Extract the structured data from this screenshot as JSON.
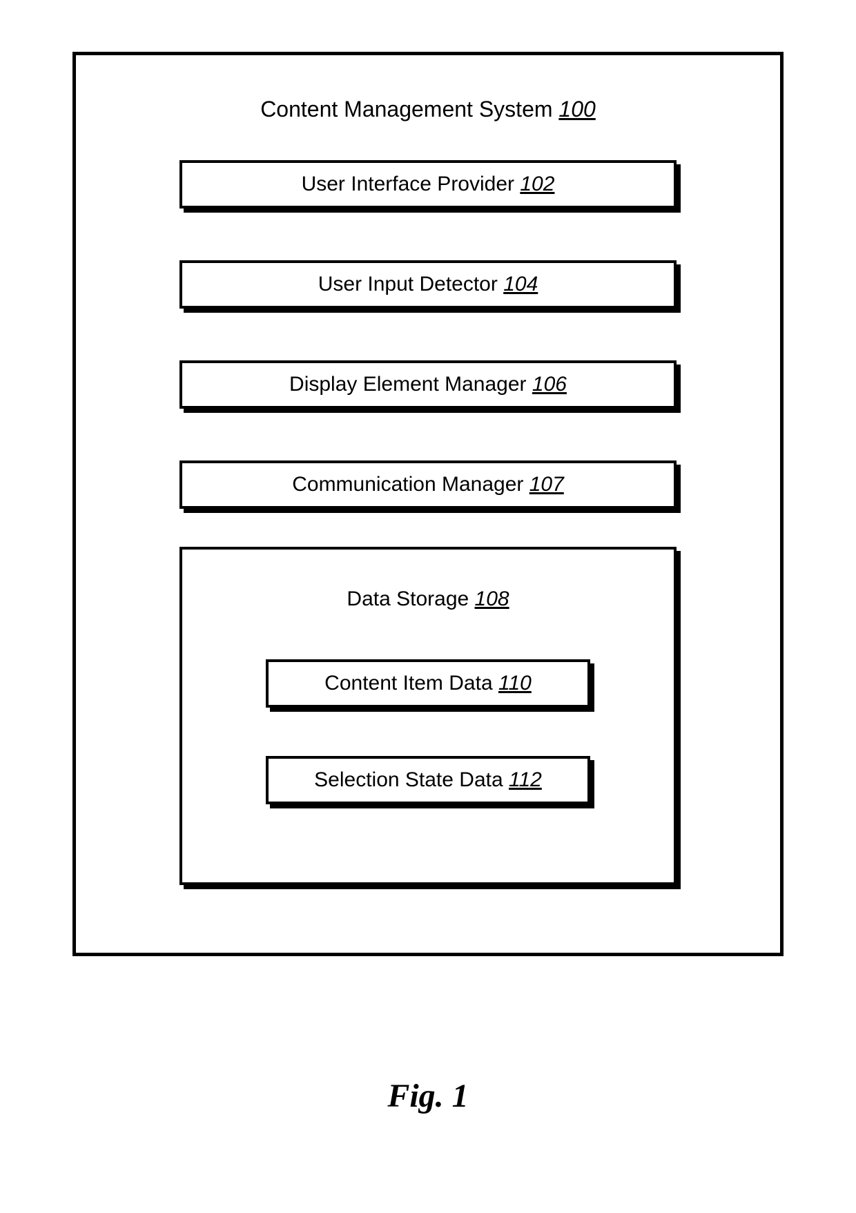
{
  "diagram": {
    "title_label": "Content Management System",
    "title_ref": "100",
    "components": [
      {
        "label": "User Interface Provider",
        "ref": "102"
      },
      {
        "label": "User Input Detector",
        "ref": "104"
      },
      {
        "label": "Display Element Manager",
        "ref": "106"
      },
      {
        "label": "Communication Manager",
        "ref": "107"
      }
    ],
    "storage": {
      "label": "Data Storage",
      "ref": "108",
      "items": [
        {
          "label": "Content Item Data",
          "ref": "110"
        },
        {
          "label": "Selection State Data",
          "ref": "112"
        }
      ]
    }
  },
  "figure_caption": "Fig. 1"
}
